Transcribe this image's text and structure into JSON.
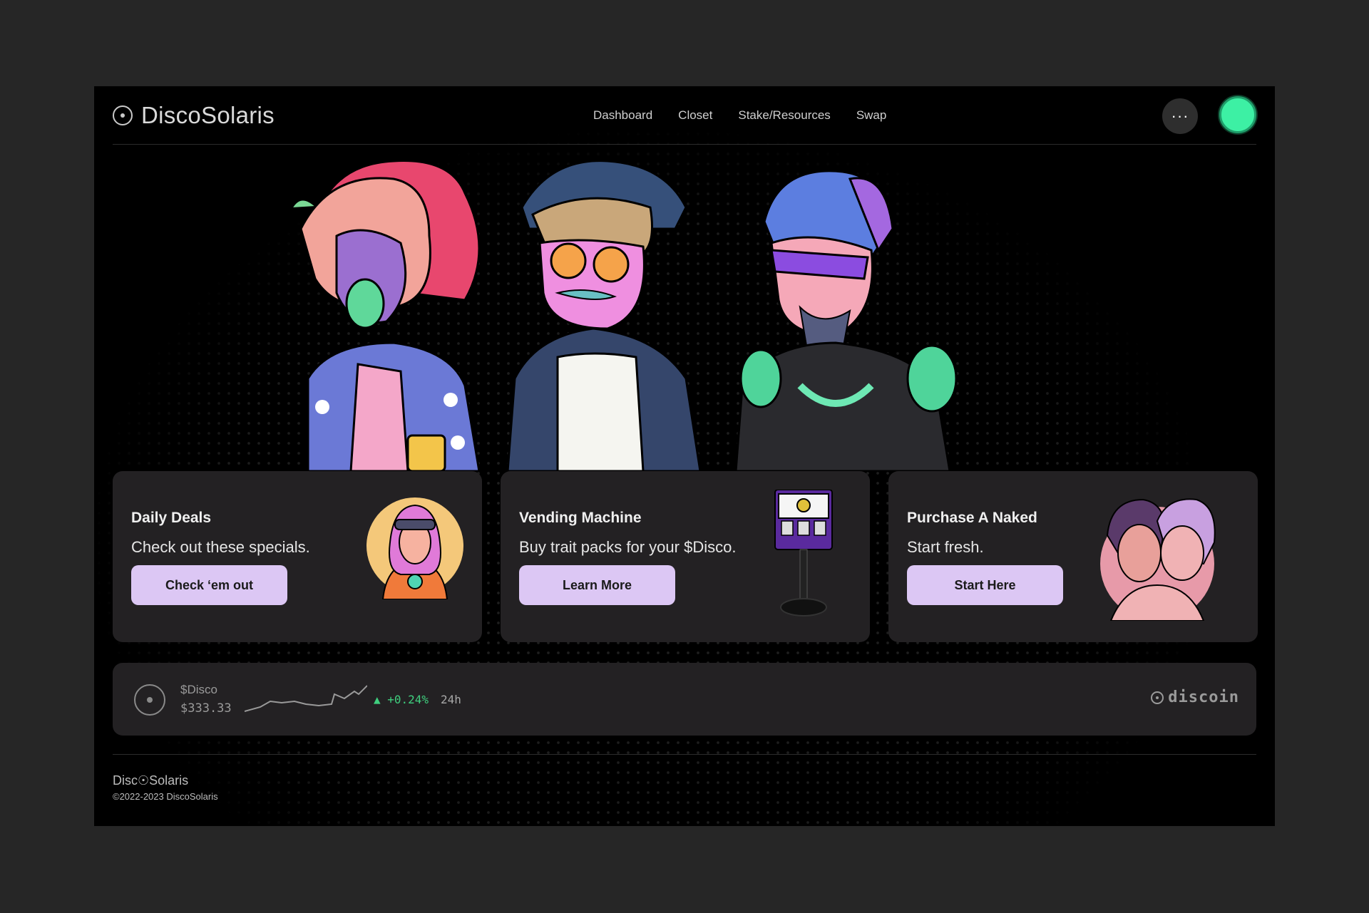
{
  "app": {
    "title": "DiscoSolaris"
  },
  "nav": {
    "items": [
      {
        "label": "Dashboard"
      },
      {
        "label": "Closet"
      },
      {
        "label": "Stake/Resources"
      },
      {
        "label": "Swap"
      }
    ],
    "more_label": "···"
  },
  "cards": [
    {
      "title": "Daily Deals",
      "subtitle": "Check out these specials.",
      "button": "Check ‘em out",
      "icon": "sunburst-portrait"
    },
    {
      "title": "Vending Machine",
      "subtitle": "Buy trait packs for your $Disco.",
      "button": "Learn More",
      "icon": "vending-machine"
    },
    {
      "title": "Purchase A Naked",
      "subtitle": "Start fresh.",
      "button": "Start Here",
      "icon": "couple-portrait"
    }
  ],
  "ticker": {
    "name": "$Disco",
    "price": "$333.33",
    "change": "▲ +0.24%",
    "period": "24h",
    "brand": "discoin"
  },
  "footer": {
    "logo": "Disc☉Solaris",
    "copyright": "©2022-2023 DiscoSolaris"
  },
  "colors": {
    "background": "#262626",
    "app_background": "#000000",
    "card": "#232123",
    "button": "#dcc7f4",
    "accent": "#3df0a4",
    "positive": "#3fcf7e"
  }
}
